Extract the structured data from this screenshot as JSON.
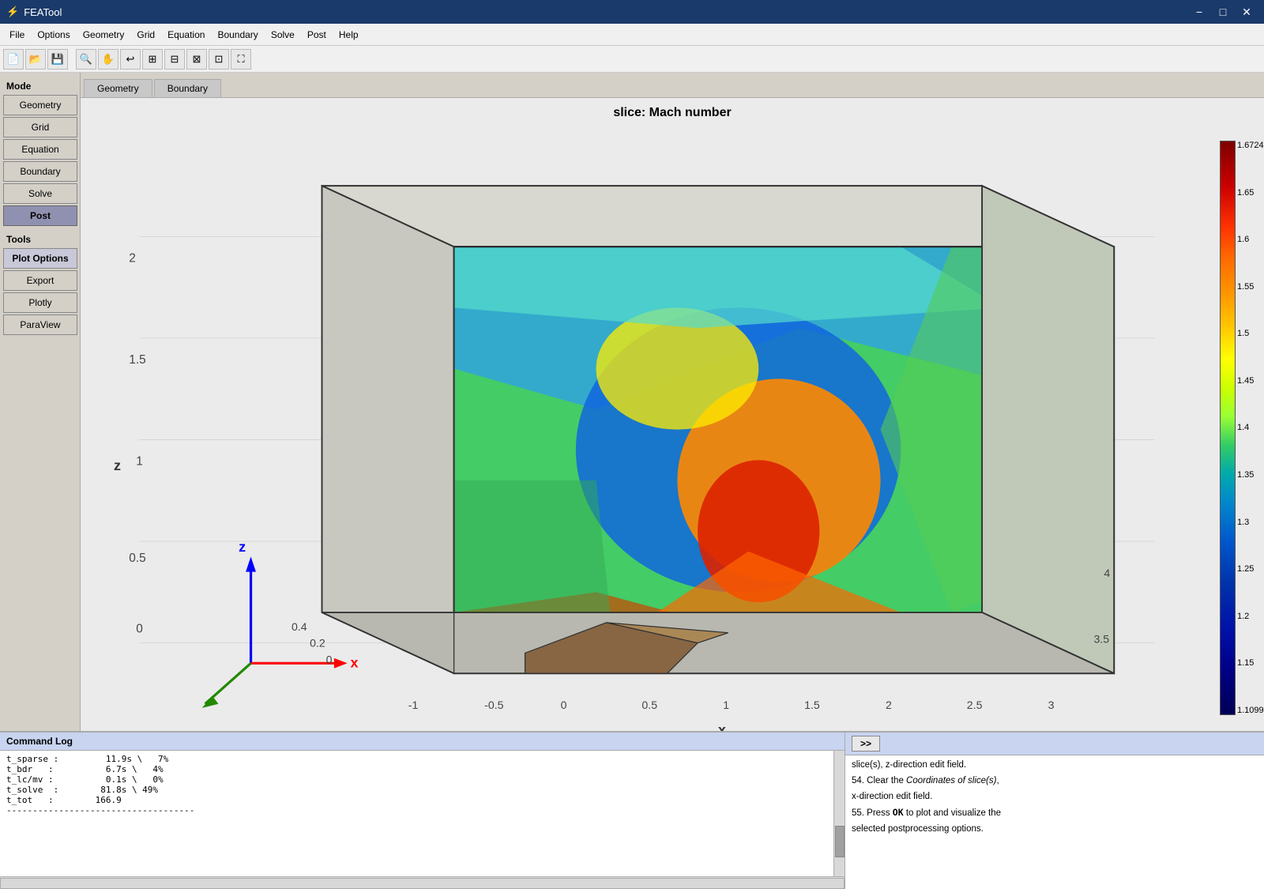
{
  "window": {
    "title": "FEATool",
    "icon": "⚡"
  },
  "titlebar": {
    "title": "FEATool",
    "minimize_label": "−",
    "maximize_label": "□",
    "close_label": "✕"
  },
  "menubar": {
    "items": [
      "File",
      "Options",
      "Geometry",
      "Grid",
      "Equation",
      "Boundary",
      "Solve",
      "Post",
      "Help"
    ]
  },
  "toolbar": {
    "buttons": [
      "📄",
      "📂",
      "💾",
      "|",
      "🔍",
      "✋",
      "↩",
      "⊞",
      "⊟",
      "⊠",
      "⊡",
      "⛶"
    ]
  },
  "sidebar": {
    "mode_label": "Mode",
    "items": [
      {
        "label": "Geometry",
        "active": false
      },
      {
        "label": "Grid",
        "active": false
      },
      {
        "label": "Equation",
        "active": false
      },
      {
        "label": "Boundary",
        "active": false
      },
      {
        "label": "Solve",
        "active": false
      },
      {
        "label": "Post",
        "active": true
      }
    ],
    "tools_label": "Tools",
    "tool_items": [
      {
        "label": "Plot Options",
        "active": false
      },
      {
        "label": "Export",
        "active": false
      },
      {
        "label": "Plotly",
        "active": false
      },
      {
        "label": "ParaView",
        "active": false
      }
    ]
  },
  "mode_tabs": [
    {
      "label": "Geometry",
      "active": false
    },
    {
      "label": "Boundary",
      "active": false
    }
  ],
  "plot": {
    "title": "slice: Mach number",
    "colorbar": {
      "max": "1.6724",
      "values": [
        "1.65",
        "1.6",
        "1.55",
        "1.5",
        "1.45",
        "1.4",
        "1.35",
        "1.3",
        "1.25",
        "1.2",
        "1.15",
        "1.1099"
      ]
    },
    "axes": {
      "x_label": "x",
      "z_label": "z",
      "x_ticks": [
        "-1",
        "-0.5",
        "0",
        "0.5",
        "1",
        "1.5",
        "2",
        "2.5",
        "3",
        "3.5",
        "4"
      ],
      "z_ticks": [
        "0",
        "0.5",
        "1",
        "1.5",
        "2"
      ],
      "y_ticks": [
        "0.4",
        "0.2",
        "0"
      ]
    }
  },
  "command_log": {
    "header": "Command Log",
    "lines": [
      "t_sparse :         11.9s \\   7%",
      "t_bdr   :          6.7s \\   4%",
      "t_lc/mv :          0.1s \\   0%",
      "t_solve  :        81.8s \\  49%",
      "t_tot   :        166.9",
      "------------------------------------"
    ]
  },
  "right_panel": {
    "cmd_button": ">>",
    "lines": [
      "slice(s), z-direction edit field.",
      "",
      "54. Clear the Coordinates of slice(s),",
      "x-direction edit field.",
      "",
      "55. Press OK to plot and visualize the",
      "selected postprocessing options."
    ]
  }
}
